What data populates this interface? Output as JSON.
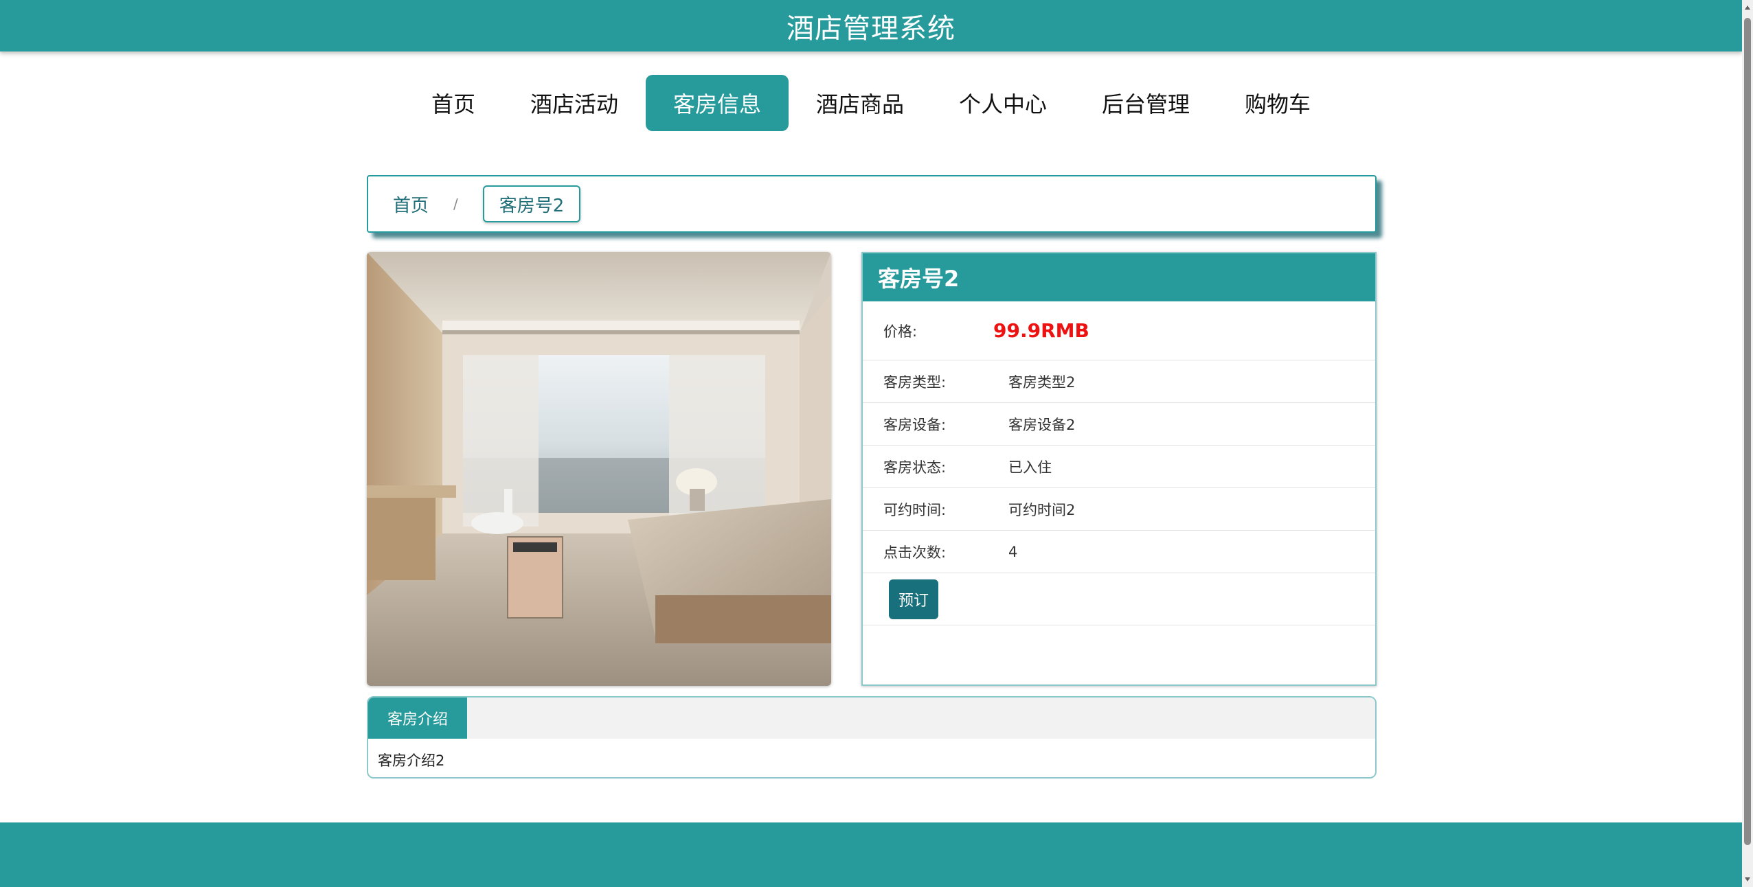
{
  "app": {
    "title": "酒店管理系统"
  },
  "nav": {
    "items": [
      {
        "label": "首页"
      },
      {
        "label": "酒店活动"
      },
      {
        "label": "客房信息",
        "active": true
      },
      {
        "label": "酒店商品"
      },
      {
        "label": "个人中心"
      },
      {
        "label": "后台管理"
      },
      {
        "label": "购物车"
      }
    ]
  },
  "breadcrumb": {
    "home": "首页",
    "separator": "/",
    "current": "客房号2"
  },
  "room": {
    "name": "客房号2",
    "price_label": "价格:",
    "price_value": "99.9RMB",
    "fields": [
      {
        "label": "客房类型:",
        "value": "客房类型2"
      },
      {
        "label": "客房设备:",
        "value": "客房设备2"
      },
      {
        "label": "客房状态:",
        "value": "已入住"
      },
      {
        "label": "可约时间:",
        "value": "可约时间2"
      },
      {
        "label": "点击次数:",
        "value": "4"
      }
    ],
    "book_label": "预订"
  },
  "intro": {
    "tab_label": "客房介绍",
    "content": "客房介绍2"
  },
  "colors": {
    "brand": "#279a9b",
    "button": "#17707c",
    "price": "#ee1111"
  },
  "icons": {
    "room_photo": "hotel-room-photo"
  }
}
